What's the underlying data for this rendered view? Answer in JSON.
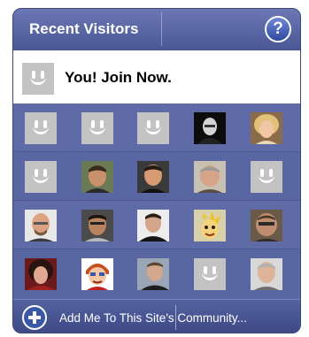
{
  "header": {
    "title": "Recent Visitors",
    "help_icon": "question-icon"
  },
  "join": {
    "label": "You! Join Now."
  },
  "footer": {
    "link_label": "Add Me To This Site's Community...",
    "add_icon": "plus-circle-icon"
  },
  "colors": {
    "panel": "#5c6aa4",
    "header": "#4a5795",
    "placeholder_avatar": "#c3c3c3",
    "text_light": "#ffffff"
  },
  "grid": {
    "rows": [
      [
        "default-avatar",
        "default-avatar",
        "default-avatar",
        "photo",
        "photo"
      ],
      [
        "default-avatar",
        "photo",
        "photo",
        "photo",
        "default-avatar"
      ],
      [
        "photo",
        "photo",
        "photo",
        "cartoon",
        "photo"
      ],
      [
        "photo",
        "cartoon",
        "photo",
        "default-avatar",
        "photo"
      ]
    ]
  }
}
